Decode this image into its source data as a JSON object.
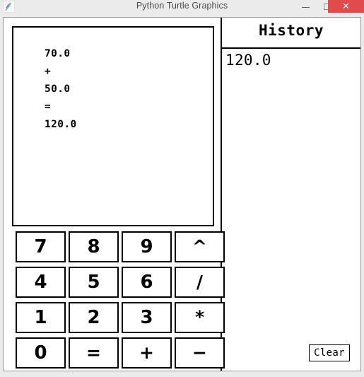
{
  "window": {
    "title": "Python Turtle Graphics",
    "icon": "python-feather-icon",
    "controls": {
      "minimize": "–",
      "maximize": "□",
      "close": "✕"
    },
    "close_color": "#e14b4b"
  },
  "display": {
    "lines": [
      "70.0",
      "+",
      "50.0",
      "=",
      "120.0"
    ]
  },
  "history": {
    "title": "History",
    "entries": [
      "120.0"
    ]
  },
  "keypad": {
    "rows": [
      [
        {
          "label": "7",
          "name": "key-7",
          "kind": "digit"
        },
        {
          "label": "8",
          "name": "key-8",
          "kind": "digit"
        },
        {
          "label": "9",
          "name": "key-9",
          "kind": "digit"
        },
        {
          "label": "^",
          "name": "key-power",
          "kind": "op"
        }
      ],
      [
        {
          "label": "4",
          "name": "key-4",
          "kind": "digit"
        },
        {
          "label": "5",
          "name": "key-5",
          "kind": "digit"
        },
        {
          "label": "6",
          "name": "key-6",
          "kind": "digit"
        },
        {
          "label": "/",
          "name": "key-divide",
          "kind": "op"
        }
      ],
      [
        {
          "label": "1",
          "name": "key-1",
          "kind": "digit"
        },
        {
          "label": "2",
          "name": "key-2",
          "kind": "digit"
        },
        {
          "label": "3",
          "name": "key-3",
          "kind": "digit"
        },
        {
          "label": "*",
          "name": "key-multiply",
          "kind": "op"
        }
      ],
      [
        {
          "label": "0",
          "name": "key-0",
          "kind": "digit"
        },
        {
          "label": "=",
          "name": "key-equals",
          "kind": "op"
        },
        {
          "label": "+",
          "name": "key-plus",
          "kind": "op"
        },
        {
          "label": "−",
          "name": "key-minus",
          "kind": "op"
        }
      ]
    ]
  },
  "clear": {
    "label": "Clear"
  }
}
